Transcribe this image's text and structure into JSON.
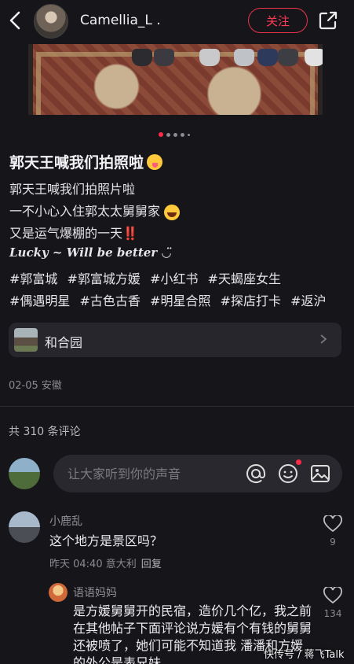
{
  "header": {
    "username": "Camellia_L .",
    "follow_label": "关注"
  },
  "carousel": {
    "dots": [
      true,
      false,
      false,
      false,
      false
    ]
  },
  "post": {
    "title": "郭天王喊我们拍照啦",
    "lines": [
      "郭天王喊我们拍照片啦",
      "一不小心入住郭太太舅舅家",
      "又是运气爆棚的一天‼️"
    ],
    "lucky": "Lucky ~ Will be better  ◡̈",
    "tags": [
      "#郭富城",
      "#郭富城方媛",
      "#小红书",
      "#天蝎座女生",
      "#偶遇明星",
      "#古色古香",
      "#明星合照",
      "#探店打卡",
      "#返沪"
    ],
    "location": "和合园",
    "date_place": "02-05 安徽"
  },
  "comments_header": {
    "count_text": "共 310 条评论"
  },
  "comment_input": {
    "placeholder": "让大家听到你的声音"
  },
  "comments": [
    {
      "user": "小鹿乱",
      "text": "这个地方是景区吗？",
      "time_place": "昨天 04:40 意大利",
      "reply": "回复",
      "likes": "9"
    },
    {
      "user": "语语妈妈",
      "text": "是方媛舅舅开的民宿，造价几个亿，我之前在其他帖子下面评论说方媛有个有钱的舅舅还被喷了，她们可能不知道我 潘潘和方媛的外公是表兄妹",
      "likes": "134"
    }
  ],
  "watermark": "快传号 / 蒋飞Talk",
  "colors": {
    "accent": "#ff2a48",
    "background": "#16161a"
  }
}
